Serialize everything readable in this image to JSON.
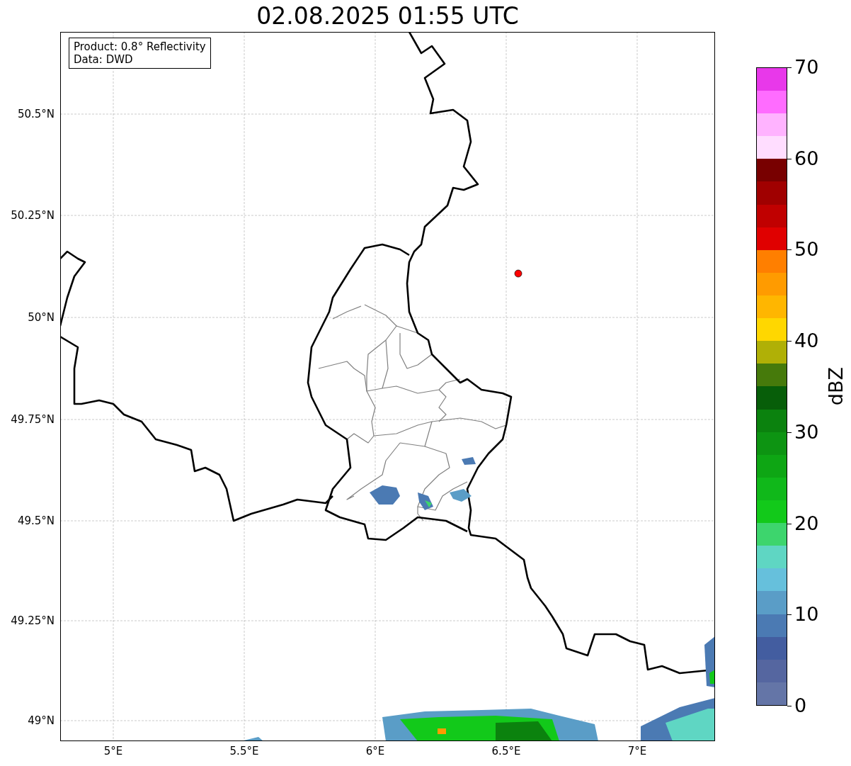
{
  "title": "02.08.2025 01:55 UTC",
  "legend": [
    "Product: 0.8° Reflectivity",
    "Data: DWD"
  ],
  "lat_labels": [
    "50.5°N",
    "50.25°N",
    "50°N",
    "49.75°N",
    "49.5°N",
    "49.25°N",
    "49°N"
  ],
  "lon_labels": [
    "5°E",
    "5.5°E",
    "6°E",
    "6.5°E",
    "7°E"
  ],
  "colorbar": {
    "label": "dBZ",
    "ticks": [
      "70",
      "60",
      "50",
      "40",
      "30",
      "20",
      "10",
      "0"
    ],
    "segments": [
      {
        "color": "#6475a7"
      },
      {
        "color": "#5566a0"
      },
      {
        "color": "#435da0"
      },
      {
        "color": "#4b7ab3"
      },
      {
        "color": "#5a9dc7"
      },
      {
        "color": "#66c0dc"
      },
      {
        "color": "#5fd6c3"
      },
      {
        "color": "#3dd56d"
      },
      {
        "color": "#12c91a"
      },
      {
        "color": "#10b81a"
      },
      {
        "color": "#0ea614"
      },
      {
        "color": "#0d9412"
      },
      {
        "color": "#0b820e"
      },
      {
        "color": "#075e09"
      },
      {
        "color": "#467a0b"
      },
      {
        "color": "#b0b006"
      },
      {
        "color": "#ffd700"
      },
      {
        "color": "#ffb600"
      },
      {
        "color": "#ff9b00"
      },
      {
        "color": "#ff7f00"
      },
      {
        "color": "#e00000"
      },
      {
        "color": "#c00000"
      },
      {
        "color": "#a00000"
      },
      {
        "color": "#780000"
      },
      {
        "color": "#ffddff"
      },
      {
        "color": "#ffb3ff"
      },
      {
        "color": "#ff6cff"
      },
      {
        "color": "#e838ea"
      }
    ]
  }
}
